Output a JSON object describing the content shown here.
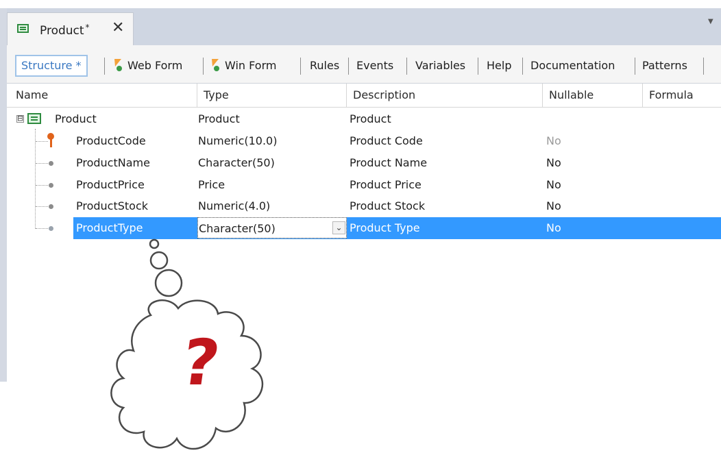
{
  "document_tab": {
    "title": "Product",
    "modified_marker": "*",
    "close_glyph": "✕",
    "overflow_glyph": "▼"
  },
  "editor_tabs": [
    {
      "label": "Structure *",
      "active": true,
      "icon": ""
    },
    {
      "label": "Web Form",
      "active": false,
      "icon": "webform-bolt-icon"
    },
    {
      "label": "Win Form",
      "active": false,
      "icon": "winform-bolt-icon"
    },
    {
      "label": "Rules",
      "active": false,
      "icon": ""
    },
    {
      "label": "Events",
      "active": false,
      "icon": ""
    },
    {
      "label": "Variables",
      "active": false,
      "icon": ""
    },
    {
      "label": "Help",
      "active": false,
      "icon": ""
    },
    {
      "label": "Documentation",
      "active": false,
      "icon": ""
    },
    {
      "label": "Patterns",
      "active": false,
      "icon": ""
    }
  ],
  "grid": {
    "columns": [
      "Name",
      "Type",
      "Description",
      "Nullable",
      "Formula"
    ],
    "root": {
      "name": "Product",
      "type": "Product",
      "description": "Product",
      "icon": "transaction-icon",
      "expander": "⊟"
    },
    "attributes": [
      {
        "name": "ProductCode",
        "type": "Numeric(10.0)",
        "description": "Product Code",
        "nullable": "No",
        "key": true,
        "selected": false
      },
      {
        "name": "ProductName",
        "type": "Character(50)",
        "description": "Product Name",
        "nullable": "No",
        "key": false,
        "selected": false
      },
      {
        "name": "ProductPrice",
        "type": "Price",
        "description": "Product Price",
        "nullable": "No",
        "key": false,
        "selected": false
      },
      {
        "name": "ProductStock",
        "type": "Numeric(4.0)",
        "description": "Product Stock",
        "nullable": "No",
        "key": false,
        "selected": false
      },
      {
        "name": "ProductType",
        "type": "Character(50)",
        "description": "Product Type",
        "nullable": "No",
        "key": false,
        "selected": true
      }
    ],
    "dropdown_glyph": "⌄"
  },
  "thought_cloud": {
    "symbol": "?"
  },
  "colors": {
    "selection": "#3399ff",
    "active_tab_text": "#3a78c2",
    "key_icon": "#e0631b",
    "question_mark": "#c0161c"
  }
}
